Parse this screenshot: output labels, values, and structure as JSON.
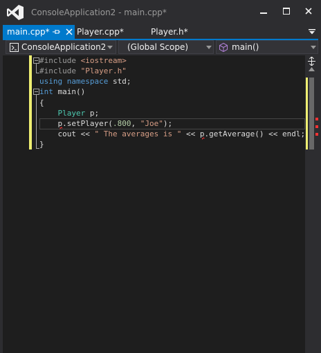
{
  "window": {
    "title": "ConsoleApplication2 - main.cpp*",
    "logo_icon": "visual-studio-logo-icon",
    "controls": [
      "minimize-icon",
      "maximize-icon",
      "close-icon"
    ]
  },
  "tabs": [
    {
      "label": "main.cpp*",
      "active": true,
      "pinned": true,
      "closable": true
    },
    {
      "label": "Player.cpp*",
      "active": false
    },
    {
      "label": "Player.h*",
      "active": false
    }
  ],
  "navigation": {
    "project": "ConsoleApplication2",
    "scope": "(Global Scope)",
    "member": "main()"
  },
  "editor": {
    "lines": [
      "#include <iostream>",
      "#include \"Player.h\"",
      "using namespace std;",
      "int main()",
      "{",
      "    Player p;",
      "    p.setPlayer(.800, \"Joe\");",
      "    cout << \" The averages is \" << p.getAverage() << endl;",
      "}"
    ],
    "tokens": {
      "include1_kw": "#include",
      "include1_arg": "<iostream>",
      "include2_kw": "#include",
      "include2_arg": "\"Player.h\"",
      "using": "using",
      "namespace": "namespace",
      "std": " std;",
      "int": "int",
      "main": " main()",
      "brace_open": "{",
      "player_type": "Player",
      "player_var": " p;",
      "setplayer_obj": "p",
      "setplayer_call": ".setPlayer(",
      "setplayer_num": ".800",
      "setplayer_comma": ", ",
      "setplayer_str": "\"Joe\"",
      "setplayer_end": ");",
      "cout_start": "cout << ",
      "cout_str": "\" The averages is \"",
      "cout_mid": " << ",
      "cout_obj": "p",
      "cout_call": ".getAverage() << endl;",
      "brace_close": "}"
    }
  },
  "colors": {
    "accent": "#007acc",
    "keyword": "#569cd6",
    "preprocessor": "#9b9b9b",
    "string": "#d69d85",
    "number": "#b5cea8",
    "type": "#4ec9b0",
    "change_bar": "#efef72",
    "error": "#ff3333"
  }
}
